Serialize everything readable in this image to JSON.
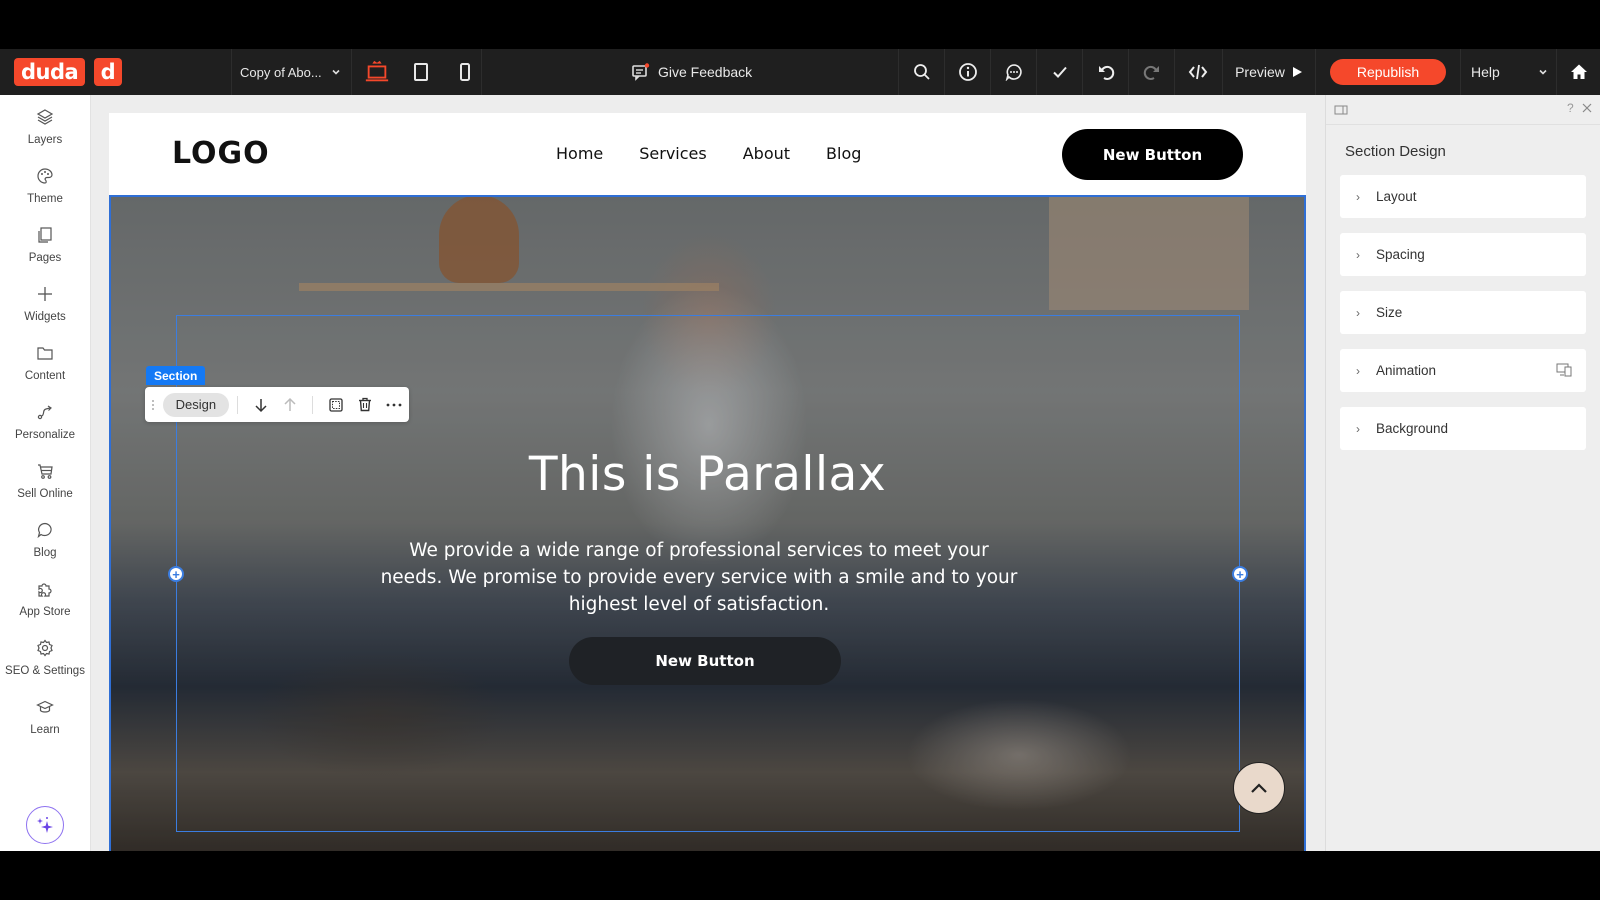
{
  "topbar": {
    "logo_text": "duda",
    "logo_mark": "d",
    "page_name": "Copy of Abo...",
    "devices": [
      {
        "name": "desktop",
        "icon": "desktop-icon",
        "active": true
      },
      {
        "name": "tablet",
        "icon": "tablet-icon",
        "active": false
      },
      {
        "name": "mobile",
        "icon": "mobile-icon",
        "active": false
      }
    ],
    "feedback_label": "Give Feedback",
    "tools": [
      "search-icon",
      "info-icon",
      "comment-icon",
      "check-icon",
      "undo-icon",
      "redo-icon",
      "code-icon"
    ],
    "preview_label": "Preview",
    "republish_label": "Republish",
    "help_label": "Help",
    "accent_color": "#f5482b"
  },
  "sidebar": {
    "items": [
      {
        "label": "Layers",
        "icon": "layers-icon"
      },
      {
        "label": "Theme",
        "icon": "palette-icon"
      },
      {
        "label": "Pages",
        "icon": "pages-icon"
      },
      {
        "label": "Widgets",
        "icon": "plus-icon"
      },
      {
        "label": "Content",
        "icon": "folder-icon"
      },
      {
        "label": "Personalize",
        "icon": "personalize-icon"
      },
      {
        "label": "Sell Online",
        "icon": "cart-icon"
      },
      {
        "label": "Blog",
        "icon": "chat-bubble-icon"
      },
      {
        "label": "App Store",
        "icon": "puzzle-icon"
      },
      {
        "label": "SEO & Settings",
        "icon": "gear-icon"
      },
      {
        "label": "Learn",
        "icon": "graduation-cap-icon"
      }
    ],
    "ai_button_icon": "sparkles-icon"
  },
  "site": {
    "logo": "LOGO",
    "nav": [
      "Home",
      "Services",
      "About",
      "Blog"
    ],
    "header_button": "New Button",
    "hero": {
      "title": "This is Parallax",
      "text": "We provide a wide range of professional services to meet your needs. We promise to provide every service with a smile and to your highest level of satisfaction.",
      "button": "New Button"
    }
  },
  "selection": {
    "tag": "Section",
    "toolbar": {
      "design_label": "Design",
      "actions": [
        "move-down-icon",
        "move-up-icon",
        "select-box-icon",
        "trash-icon",
        "more-icon"
      ]
    },
    "outline_color": "#2f6fd6"
  },
  "panel": {
    "help": "?",
    "title": "Section Design",
    "sections": [
      {
        "label": "Layout"
      },
      {
        "label": "Spacing"
      },
      {
        "label": "Size"
      },
      {
        "label": "Animation",
        "extra_icon": "responsive-devices-icon"
      },
      {
        "label": "Background"
      }
    ]
  }
}
